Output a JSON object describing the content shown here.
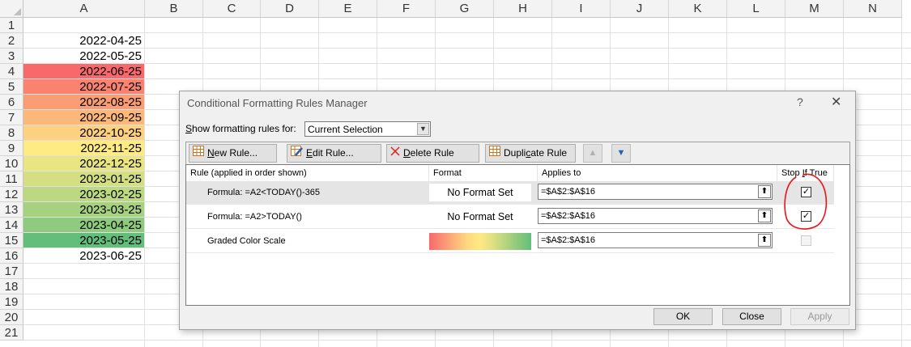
{
  "columns": [
    "A",
    "B",
    "C",
    "D",
    "E",
    "F",
    "G",
    "H",
    "I",
    "J",
    "K",
    "L",
    "M",
    "N"
  ],
  "rows": [
    "1",
    "2",
    "3",
    "4",
    "5",
    "6",
    "7",
    "8",
    "9",
    "10",
    "11",
    "12",
    "13",
    "14",
    "15",
    "16",
    "17",
    "18",
    "19",
    "20",
    "21"
  ],
  "column_a_cells": [
    {
      "row": 2,
      "value": "2022-04-25",
      "fill": ""
    },
    {
      "row": 3,
      "value": "2022-05-25",
      "fill": ""
    },
    {
      "row": 4,
      "value": "2022-06-25",
      "fill": "#f8696b"
    },
    {
      "row": 5,
      "value": "2022-07-25",
      "fill": "#f98370"
    },
    {
      "row": 6,
      "value": "2022-08-25",
      "fill": "#fa9d75"
    },
    {
      "row": 7,
      "value": "2022-09-25",
      "fill": "#fcb77a"
    },
    {
      "row": 8,
      "value": "2022-10-25",
      "fill": "#fdd17f"
    },
    {
      "row": 9,
      "value": "2022-11-25",
      "fill": "#ffeb84"
    },
    {
      "row": 10,
      "value": "2022-12-25",
      "fill": "#e9e583"
    },
    {
      "row": 11,
      "value": "2023-01-25",
      "fill": "#d3df82"
    },
    {
      "row": 12,
      "value": "2023-02-25",
      "fill": "#bcd881"
    },
    {
      "row": 13,
      "value": "2023-03-25",
      "fill": "#a6d27f"
    },
    {
      "row": 14,
      "value": "2023-04-25",
      "fill": "#8fcb7e"
    },
    {
      "row": 15,
      "value": "2023-05-25",
      "fill": "#63be7b"
    },
    {
      "row": 16,
      "value": "2023-06-25",
      "fill": ""
    }
  ],
  "dialog": {
    "title": "Conditional Formatting Rules Manager",
    "help_glyph": "?",
    "close_glyph": "✕",
    "show_for_label_key": "S",
    "show_for_label_rest": "how formatting rules for:",
    "show_for_value": "Current Selection",
    "toolbar": {
      "new_rule_key": "N",
      "new_rule_rest": "ew Rule...",
      "edit_rule_key": "E",
      "edit_rule_rest": "dit Rule...",
      "delete_rule_key": "D",
      "delete_rule_rest": "elete Rule",
      "duplicate_rule_pre": "Dupli",
      "duplicate_rule_key": "c",
      "duplicate_rule_rest": "ate Rule",
      "move_up_glyph": "▲",
      "move_down_glyph": "▼"
    },
    "list_headers": {
      "rule": "Rule (applied in order shown)",
      "format": "Format",
      "applies_to": "Applies to",
      "stop_pre": "Stop ",
      "stop_key": "I",
      "stop_rest": "f True"
    },
    "rules": [
      {
        "name": "Formula: =A2<TODAY()-365",
        "format": "No Format Set",
        "applies_to": "=$A$2:$A$16",
        "stop_if_true": true,
        "selected": true
      },
      {
        "name": "Formula: =A2>TODAY()",
        "format": "No Format Set",
        "applies_to": "=$A$2:$A$16",
        "stop_if_true": true,
        "selected": false
      },
      {
        "name": "Graded Color Scale",
        "format": "",
        "applies_to": "=$A$2:$A$16",
        "stop_if_true": false,
        "selected": false
      }
    ],
    "collapse_glyph": "⬆",
    "ok_label": "OK",
    "close_label": "Close",
    "apply_label": "Apply"
  },
  "colors": {
    "scale_low": "#f8696b",
    "scale_mid": "#ffeb84",
    "scale_high": "#63be7b",
    "annotation": "#e8141a"
  }
}
